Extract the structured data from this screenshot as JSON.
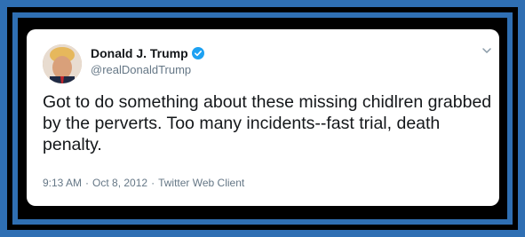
{
  "tweet": {
    "display_name": "Donald J. Trump",
    "handle": "@realDonaldTrump",
    "text": "Got to do something about these missing chidlren grabbed by the perverts. Too many incidents--fast trial, death penalty.",
    "time": "9:13 AM",
    "separator": "·",
    "date": "Oct 8, 2012",
    "client": "Twitter Web Client"
  },
  "icons": {
    "verified": "verified-badge-icon",
    "menu": "chevron-down-icon"
  },
  "colors": {
    "border_blue": "#2f6fb3",
    "verified_blue": "#1da1f2",
    "meta_gray": "#657786"
  }
}
